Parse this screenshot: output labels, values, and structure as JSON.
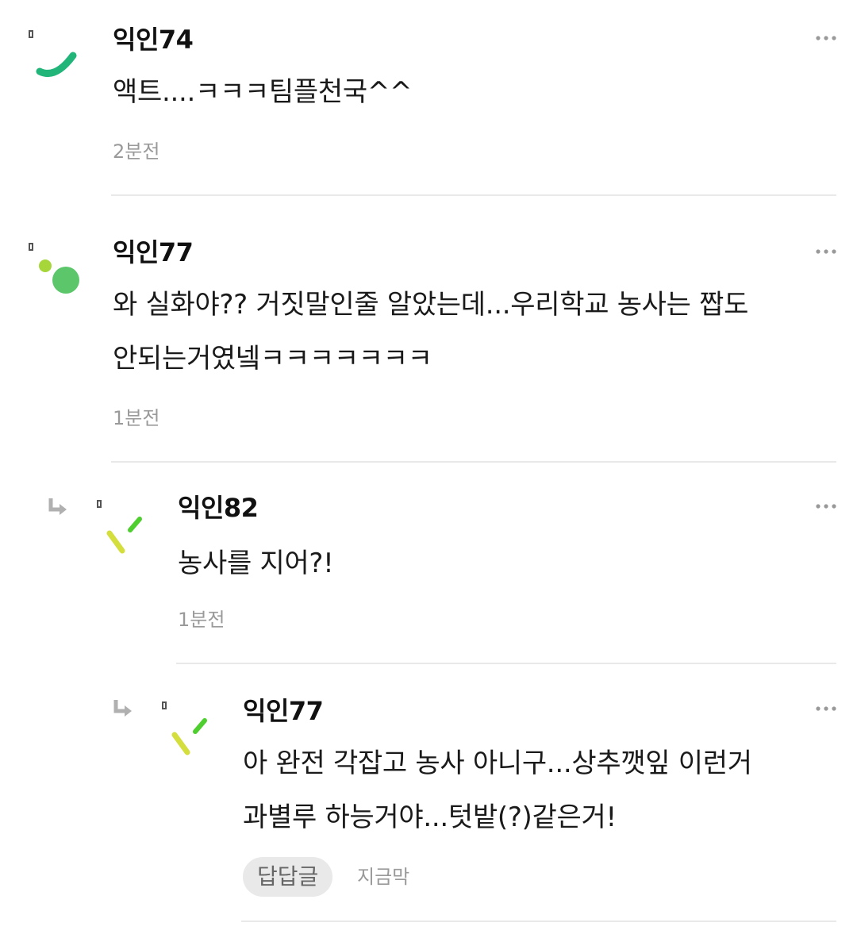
{
  "comments": [
    {
      "author": "익인74",
      "text": "액트....ㅋㅋㅋ팀플천국^^",
      "time": "2분전"
    },
    {
      "author": "익인77",
      "text_line1": "와 실화야?? 거짓말인줄 알았는데...우리학교 농사는 짭도",
      "text_line2": "안되는거였넼ㅋㅋㅋㅋㅋㅋㅋ",
      "time": "1분전"
    },
    {
      "author": "익인82",
      "text": "농사를 지어?!",
      "time": "1분전"
    },
    {
      "author": "익인77",
      "text_line1": "아 완전 각잡고 농사 아니구...상추깻잎 이런거",
      "text_line2": "과별루 하능거야...텃밭(?)같은거!",
      "reply_label": "답답글",
      "time": "지금막"
    }
  ],
  "icons": {
    "more": "more-horizontal-icon",
    "reply_arrow": "reply-arrow-icon"
  },
  "colors": {
    "avatar_green": "#22b57a",
    "avatar_lime": "#a6d63a",
    "avatar_yellow": "#d4de3c",
    "avatar_bright_green": "#4fcf2f",
    "muted_text": "#9a9a9a",
    "divider": "#e9e9e9"
  }
}
